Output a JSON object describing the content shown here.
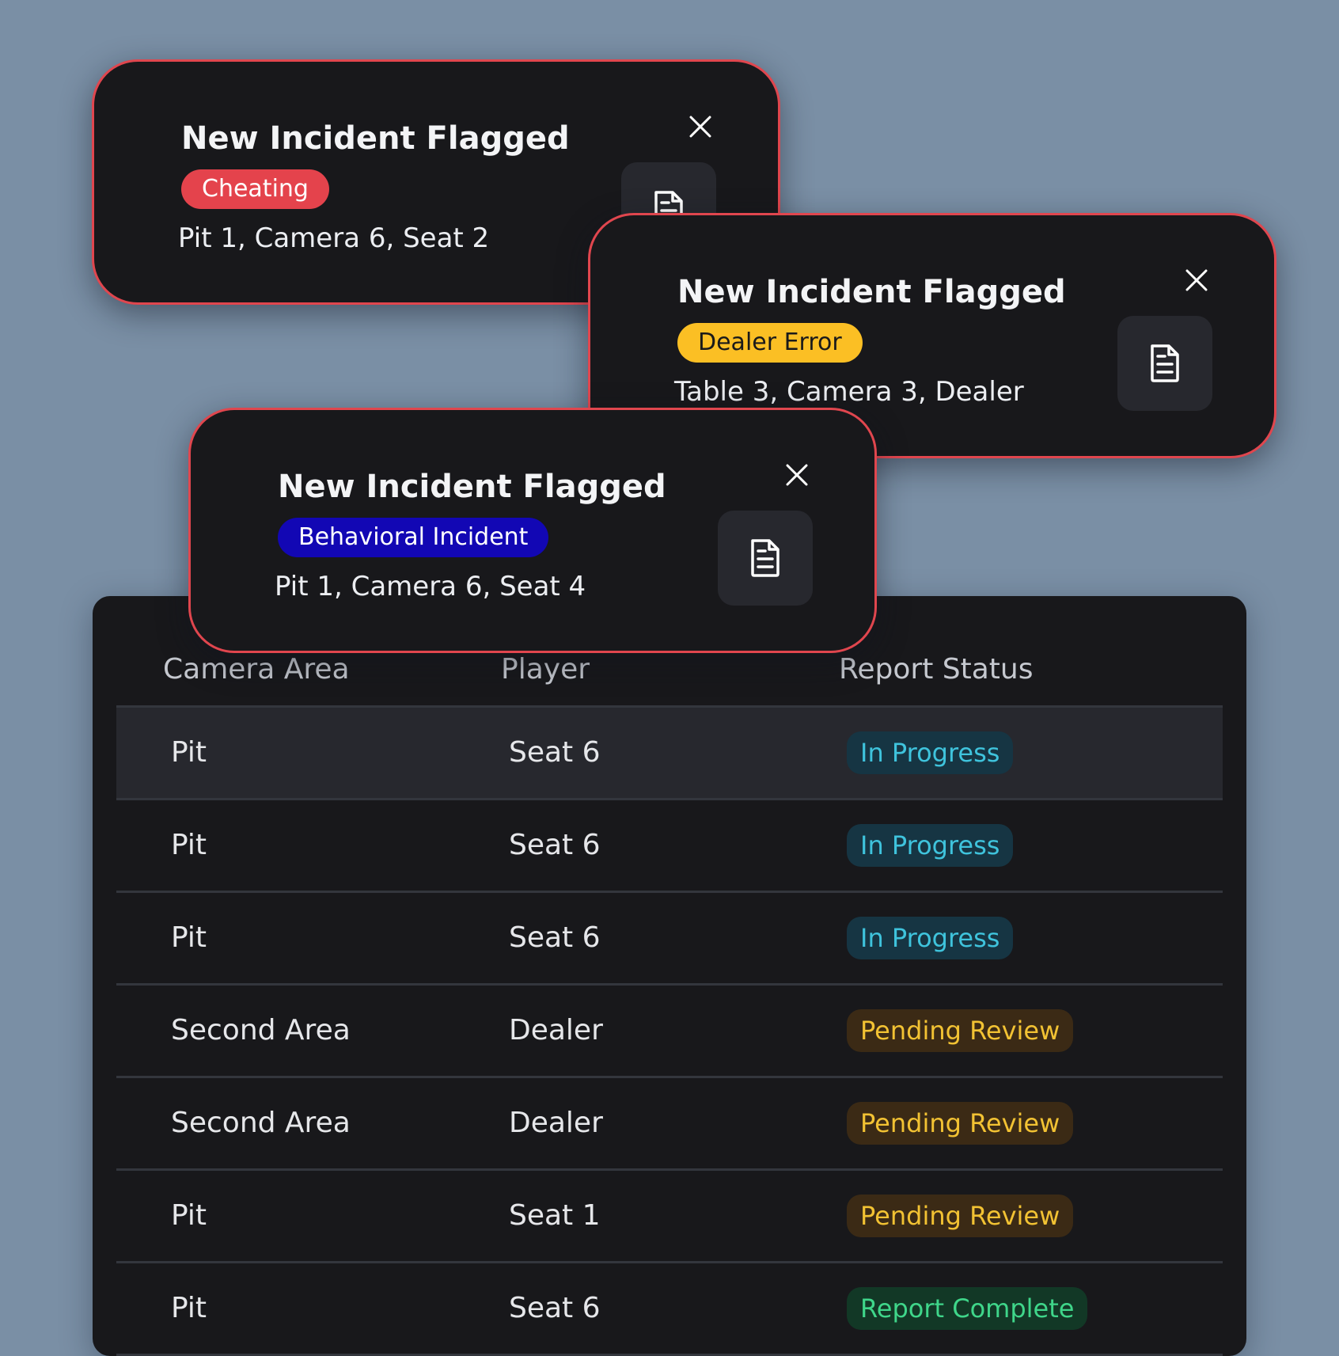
{
  "table": {
    "columns": [
      "Camera Area",
      "Player",
      "Report Status"
    ],
    "rows": [
      {
        "area": "Pit",
        "player": "Seat 6",
        "status": "In Progress"
      },
      {
        "area": "Pit",
        "player": "Seat 6",
        "status": "In Progress"
      },
      {
        "area": "Pit",
        "player": "Seat 6",
        "status": "In Progress"
      },
      {
        "area": "Second Area",
        "player": "Dealer",
        "status": "Pending Review"
      },
      {
        "area": "Second Area",
        "player": "Dealer",
        "status": "Pending Review"
      },
      {
        "area": "Pit",
        "player": "Seat 1",
        "status": "Pending Review"
      },
      {
        "area": "Pit",
        "player": "Seat 6",
        "status": "Report Complete"
      }
    ]
  },
  "toasts": [
    {
      "title": "New Incident Flagged",
      "tag": "Cheating",
      "location": "Pit 1, Camera 6, Seat 2"
    },
    {
      "title": "New Incident Flagged",
      "tag": "Dealer Error",
      "location": "Table 3, Camera 3, Dealer"
    },
    {
      "title": "New Incident Flagged",
      "tag": "Behavioral Incident",
      "location": "Pit 1, Camera 6, Seat 4"
    }
  ],
  "icons": {
    "close": "close-icon",
    "report": "document-icon"
  },
  "colors": {
    "background": "#7a8fa5",
    "panel": "#18181b",
    "toast_border": "#e0464e",
    "tag_cheating": "#e4434c",
    "tag_dealer_error": "#fbbf24",
    "tag_behavioral": "#1207b4",
    "status_in_progress": "#3fc3dc",
    "status_pending_review": "#f2c233",
    "status_report_complete": "#3fd68a"
  }
}
